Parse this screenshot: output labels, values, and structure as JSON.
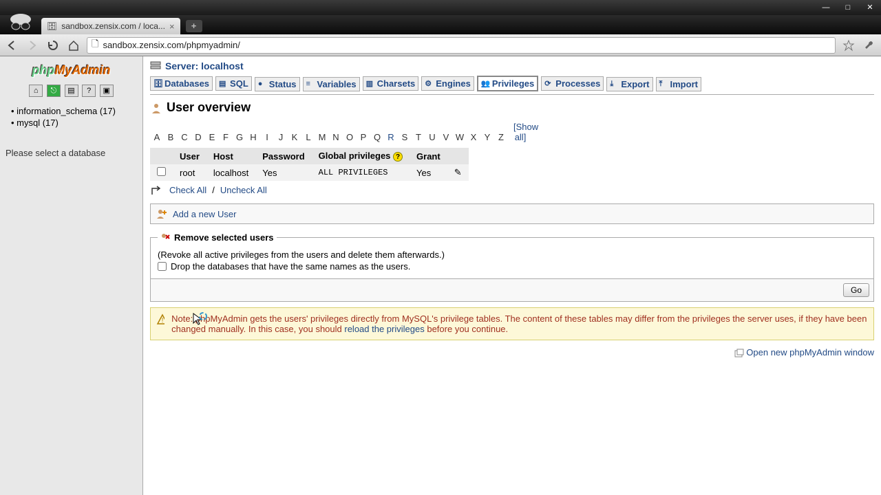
{
  "browser": {
    "tab_title": "sandbox.zensix.com / loca...",
    "url": "sandbox.zensix.com/phpmyadmin/"
  },
  "app": {
    "logo_parts": [
      "php",
      "My",
      "Admin"
    ]
  },
  "sidebar": {
    "databases": [
      {
        "name": "information_schema",
        "count": "17"
      },
      {
        "name": "mysql",
        "count": "17"
      }
    ],
    "select_prompt": "Please select a database"
  },
  "breadcrumb": {
    "label": "Server: localhost"
  },
  "tabs": [
    {
      "label": "Databases",
      "active": false
    },
    {
      "label": "SQL",
      "active": false
    },
    {
      "label": "Status",
      "active": false
    },
    {
      "label": "Variables",
      "active": false
    },
    {
      "label": "Charsets",
      "active": false
    },
    {
      "label": "Engines",
      "active": false
    },
    {
      "label": "Privileges",
      "active": true
    },
    {
      "label": "Processes",
      "active": false
    },
    {
      "label": "Export",
      "active": false
    },
    {
      "label": "Import",
      "active": false
    }
  ],
  "page": {
    "title": "User overview",
    "alphabet": [
      "A",
      "B",
      "C",
      "D",
      "E",
      "F",
      "G",
      "H",
      "I",
      "J",
      "K",
      "L",
      "M",
      "N",
      "O",
      "P",
      "Q",
      "R",
      "S",
      "T",
      "U",
      "V",
      "W",
      "X",
      "Y",
      "Z"
    ],
    "alpha_active": "R",
    "show_all": "[Show all]",
    "table": {
      "headers": [
        "User",
        "Host",
        "Password",
        "Global privileges",
        "Grant"
      ],
      "rows": [
        {
          "user": "root",
          "host": "localhost",
          "password": "Yes",
          "privileges": "ALL PRIVILEGES",
          "grant": "Yes"
        }
      ]
    },
    "check_all": "Check All",
    "uncheck_all": "Uncheck All",
    "add_user": "Add a new User",
    "remove": {
      "legend": "Remove selected users",
      "desc": "(Revoke all active privileges from the users and delete them afterwards.)",
      "drop_label": "Drop the databases that have the same names as the users."
    },
    "go": "Go",
    "note_pre": "Note: phpMyAdmin gets the users' privileges directly from MySQL's privilege tables. The content of these tables may differ from the privileges the server uses, if they have been changed manually. In this case, you should ",
    "note_link": "reload the privileges",
    "note_post": " before you continue.",
    "open_new": "Open new phpMyAdmin window"
  }
}
